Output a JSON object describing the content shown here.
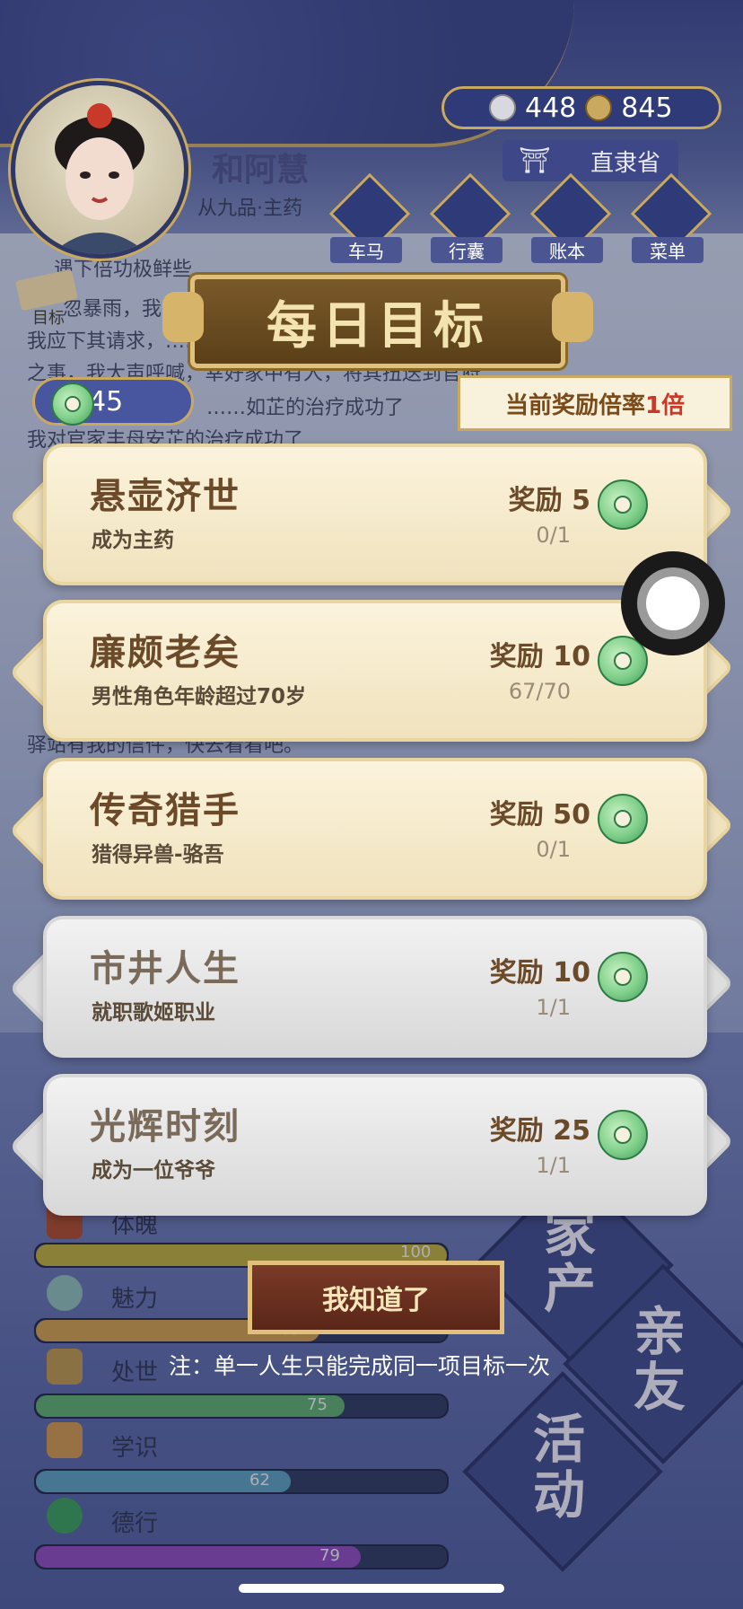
{
  "header": {
    "name": "和阿慧",
    "rank": "从九品·主药",
    "silver": "448",
    "copper": "845",
    "region": "直隶省",
    "nav": [
      {
        "label": "车马",
        "icon": "carriage-icon"
      },
      {
        "label": "行囊",
        "icon": "bag-icon"
      },
      {
        "label": "账本",
        "icon": "ledger-icon"
      },
      {
        "label": "菜单",
        "icon": "menu-dots-icon"
      }
    ],
    "goal_label": "目标"
  },
  "log": [
    "遇下倍功极鲜些……",
    "忽暴雨，我……我家来避雨",
    "我应下其请求，……欲对我行不轨",
    "之事，我大声呼喊，幸好家中有人，将其扭送到官府",
    "……如芷的治疗成功了",
    "我对官家丰母安芷的治疗成功了",
    "驿站有我的信件，快去看看吧。"
  ],
  "dialog": {
    "title": "每日目标",
    "multiplier_prefix": "当前奖励倍率",
    "multiplier_value": "1倍",
    "jade_count": "45",
    "reward_prefix": "奖励",
    "goals": [
      {
        "title": "悬壶济世",
        "subtitle": "成为主药",
        "reward": "奖励 5",
        "progress": "0/1",
        "status": "active"
      },
      {
        "title": "廉颇老矣",
        "subtitle": "男性角色年龄超过70岁",
        "reward": "奖励 10",
        "progress": "67/70",
        "status": "active"
      },
      {
        "title": "传奇猎手",
        "subtitle": "猎得异兽-骆吾",
        "reward": "奖励 50",
        "progress": "0/1",
        "status": "active"
      },
      {
        "title": "市井人生",
        "subtitle": "就职歌姬职业",
        "reward": "奖励 10",
        "progress": "1/1",
        "status": "done"
      },
      {
        "title": "光辉时刻",
        "subtitle": "成为一位爷爷",
        "reward": "奖励 25",
        "progress": "1/1",
        "status": "done"
      }
    ],
    "confirm_label": "我知道了",
    "note": "注：单一人生只能完成同一项目标一次"
  },
  "stats": [
    {
      "label": "体魄",
      "value": "100",
      "fraction": 1.0,
      "color": "#b8a83a",
      "icon": "physique-icon"
    },
    {
      "label": "魅力",
      "value": "69",
      "fraction": 0.69,
      "color": "#c99a4a",
      "icon": "charm-icon"
    },
    {
      "label": "处世",
      "value": "75",
      "fraction": 0.75,
      "color": "#5aa86a",
      "icon": "worldly-icon"
    },
    {
      "label": "学识",
      "value": "62",
      "fraction": 0.62,
      "color": "#5a9ab8",
      "icon": "knowledge-icon"
    },
    {
      "label": "德行",
      "value": "79",
      "fraction": 0.79,
      "color": "#8a4ab8",
      "icon": "virtue-icon"
    }
  ],
  "side_actions": [
    {
      "label": "家产"
    },
    {
      "label": "亲友"
    },
    {
      "label": "活动"
    }
  ]
}
